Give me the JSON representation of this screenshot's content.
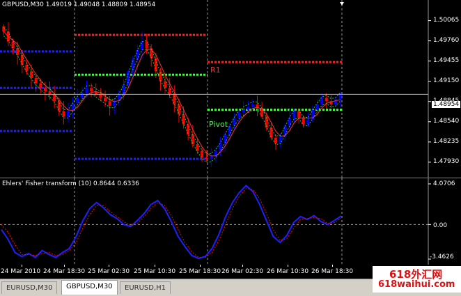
{
  "main_chart": {
    "header": "GBPUSD,M30  1.49019 1.49048 1.48809 1.48954",
    "current_price": "1.48954",
    "price_labels": [
      "1.50065",
      "1.49760",
      "1.49455",
      "1.49150",
      "1.48845",
      "1.48540",
      "1.48235",
      "1.47930"
    ],
    "level_labels": {
      "r1": "R1",
      "pivot": "Pivot"
    }
  },
  "indicator": {
    "header": "Ehlers' Fisher transform (10) 0.8644 0.6336",
    "scale_labels": [
      "4.0706",
      "0.00",
      "-3.4626"
    ]
  },
  "time_axis": [
    "24 Mar 2010",
    "24 Mar 18:30",
    "25 Mar 02:30",
    "25 Mar 10:30",
    "25 Mar 18:30",
    "26 Mar 02:30",
    "26 Mar 10:30",
    "26 Mar 18:30"
  ],
  "tabs": [
    {
      "label": "EURUSD,M30",
      "active": false
    },
    {
      "label": "GBPUSD,M30",
      "active": true
    },
    {
      "label": "EURUSD,H1",
      "active": false
    }
  ],
  "watermark": {
    "line1": "618外汇网",
    "line2": "618waihui.com"
  },
  "colors": {
    "bull": "#0000ff",
    "bear": "#ff0000",
    "resistance": "#ff2020",
    "pivot": "#40ff40",
    "support": "#2020ff",
    "fisher": "#2020ff",
    "signal": "#ff0000"
  },
  "chart_data": [
    {
      "type": "candlestick",
      "title": "GBPUSD,M30",
      "ylim": [
        1.4775,
        1.5025
      ],
      "close_series": [
        1.499,
        1.4975,
        1.4965,
        1.4955,
        1.494,
        1.493,
        1.492,
        1.4912,
        1.4905,
        1.49,
        1.4895,
        1.4885,
        1.487,
        1.4862,
        1.487,
        1.4882,
        1.489,
        1.4898,
        1.4905,
        1.49,
        1.4895,
        1.489,
        1.4885,
        1.4878,
        1.4885,
        1.4895,
        1.491,
        1.493,
        1.4948,
        1.4962,
        1.4975,
        1.4965,
        1.495,
        1.493,
        1.4915,
        1.4905,
        1.4895,
        1.488,
        1.4865,
        1.485,
        1.4835,
        1.482,
        1.481,
        1.48,
        1.4798,
        1.4802,
        1.481,
        1.4822,
        1.4835,
        1.4848,
        1.486,
        1.4868,
        1.4872,
        1.4876,
        1.488,
        1.4875,
        1.4862,
        1.4845,
        1.483,
        1.4822,
        1.4832,
        1.4848,
        1.486,
        1.487,
        1.486,
        1.485,
        1.4858,
        1.4872,
        1.488,
        1.489,
        1.4885,
        1.488,
        1.4888,
        1.4895
      ],
      "levels": [
        {
          "name": "R1",
          "value": 1.4944,
          "color": "red"
        },
        {
          "name": "Pivot",
          "value": 1.4872,
          "color": "green"
        },
        {
          "name": "R",
          "value": 1.4985,
          "color": "red"
        },
        {
          "name": "P",
          "value": 1.4925,
          "color": "green"
        },
        {
          "name": "S",
          "value": 1.4798,
          "color": "blue"
        }
      ]
    },
    {
      "type": "line",
      "title": "Ehlers' Fisher transform (10)",
      "ylim": [
        -3.4626,
        4.0706
      ],
      "series": [
        {
          "name": "Fisher",
          "values": [
            -0.5,
            -1.5,
            -2.8,
            -3.2,
            -2.9,
            -3.3,
            -2.6,
            -3.0,
            -3.3,
            -2.8,
            -2.4,
            -1.2,
            0.4,
            1.6,
            2.2,
            1.7,
            1.0,
            0.6,
            0.0,
            -0.2,
            0.4,
            1.1,
            2.0,
            2.4,
            1.6,
            0.3,
            -1.2,
            -2.2,
            -3.1,
            -3.4,
            -3.2,
            -2.4,
            -1.0,
            0.8,
            2.2,
            3.2,
            3.9,
            3.3,
            2.0,
            0.4,
            -1.2,
            -1.8,
            -1.1,
            0.2,
            0.8,
            0.5,
            0.9,
            0.3,
            0.0,
            0.4,
            0.86
          ]
        },
        {
          "name": "Signal",
          "values": [
            0.0,
            -0.8,
            -2.0,
            -3.0,
            -3.0,
            -3.1,
            -2.9,
            -2.8,
            -3.1,
            -3.0,
            -2.6,
            -1.8,
            -0.3,
            1.0,
            1.9,
            1.9,
            1.3,
            0.8,
            0.3,
            -0.1,
            0.1,
            0.8,
            1.6,
            2.2,
            1.9,
            0.9,
            -0.5,
            -1.8,
            -2.7,
            -3.3,
            -3.3,
            -2.8,
            -1.6,
            0.0,
            1.6,
            2.8,
            3.6,
            3.5,
            2.6,
            1.1,
            -0.5,
            -1.6,
            -1.4,
            -0.4,
            0.5,
            0.6,
            0.7,
            0.6,
            0.1,
            0.2,
            0.63
          ]
        }
      ]
    }
  ]
}
